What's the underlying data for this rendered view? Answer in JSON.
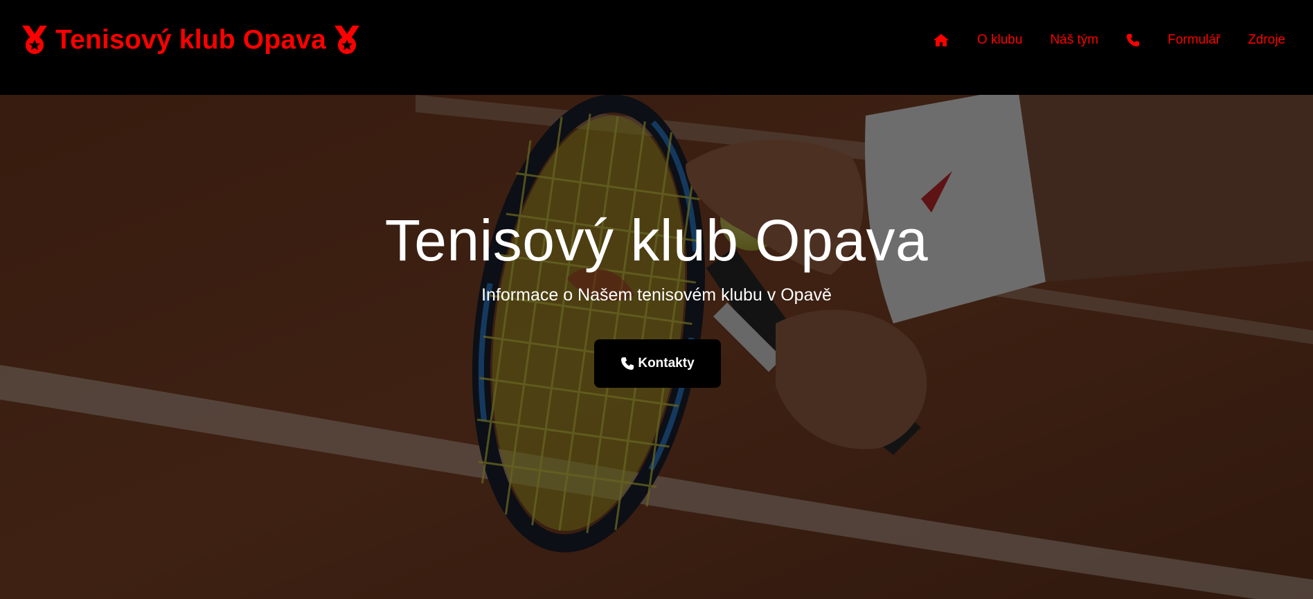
{
  "brand": {
    "title": "Tenisový klub Opava",
    "color": "#ff0000",
    "icon": "medal-icon"
  },
  "nav": {
    "items": [
      {
        "icon": "home-icon",
        "label": ""
      },
      {
        "label": "O klubu"
      },
      {
        "label": "Náš tým"
      },
      {
        "icon": "phone-icon",
        "label": ""
      },
      {
        "label": "Formulář"
      },
      {
        "label": "Zdroje"
      }
    ]
  },
  "hero": {
    "title": "Tenisový klub Opava",
    "subtitle": "Informace o Našem tenisovém klubu v Opavě",
    "button_label": "Kontakty",
    "button_icon": "phone-icon",
    "background": "tennis-player-racket-photo"
  }
}
